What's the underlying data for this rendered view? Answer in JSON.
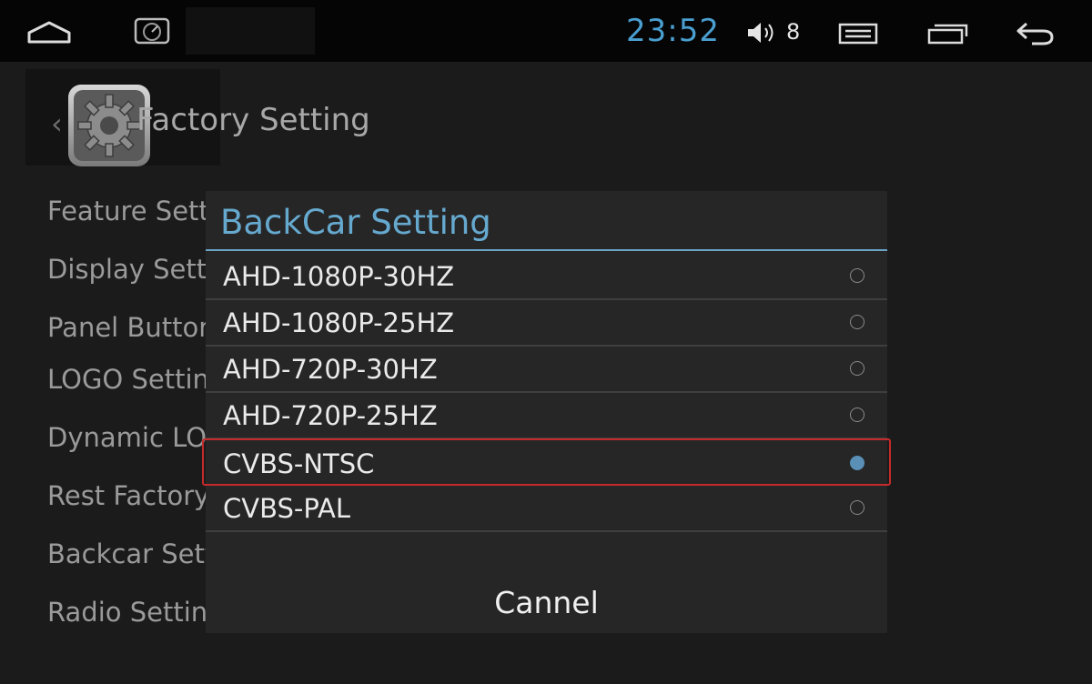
{
  "status_bar": {
    "icons": [
      "home-icon",
      "gauge-icon",
      "volume-icon",
      "menu-icon",
      "recents-icon",
      "back-icon"
    ],
    "time": "23:52",
    "volume": "8",
    "colors": {
      "clock": "#4a9fd0",
      "background": "#050505"
    }
  },
  "header": {
    "title": "Factory Setting",
    "icon": "gear-icon",
    "back": "‹"
  },
  "settings_menu": {
    "items": [
      "Feature Sett",
      "Display Setti",
      "Panel Button",
      "LOGO Setting",
      "Dynamic LOG",
      "Rest Factory",
      "Backcar Sett",
      "Radio Setting"
    ]
  },
  "dialog": {
    "title": "BackCar Setting",
    "options": [
      {
        "label": "AHD-1080P-30HZ",
        "selected": false
      },
      {
        "label": "AHD-1080P-25HZ",
        "selected": false
      },
      {
        "label": "AHD-720P-30HZ",
        "selected": false
      },
      {
        "label": "AHD-720P-25HZ",
        "selected": false
      },
      {
        "label": "CVBS-NTSC",
        "selected": true
      },
      {
        "label": "CVBS-PAL",
        "selected": false
      }
    ],
    "cancel_label": "Cannel",
    "colors": {
      "title": "#66a9cf",
      "highlight": "#c52a2a",
      "radio_checked": "#5a8fb6"
    }
  }
}
